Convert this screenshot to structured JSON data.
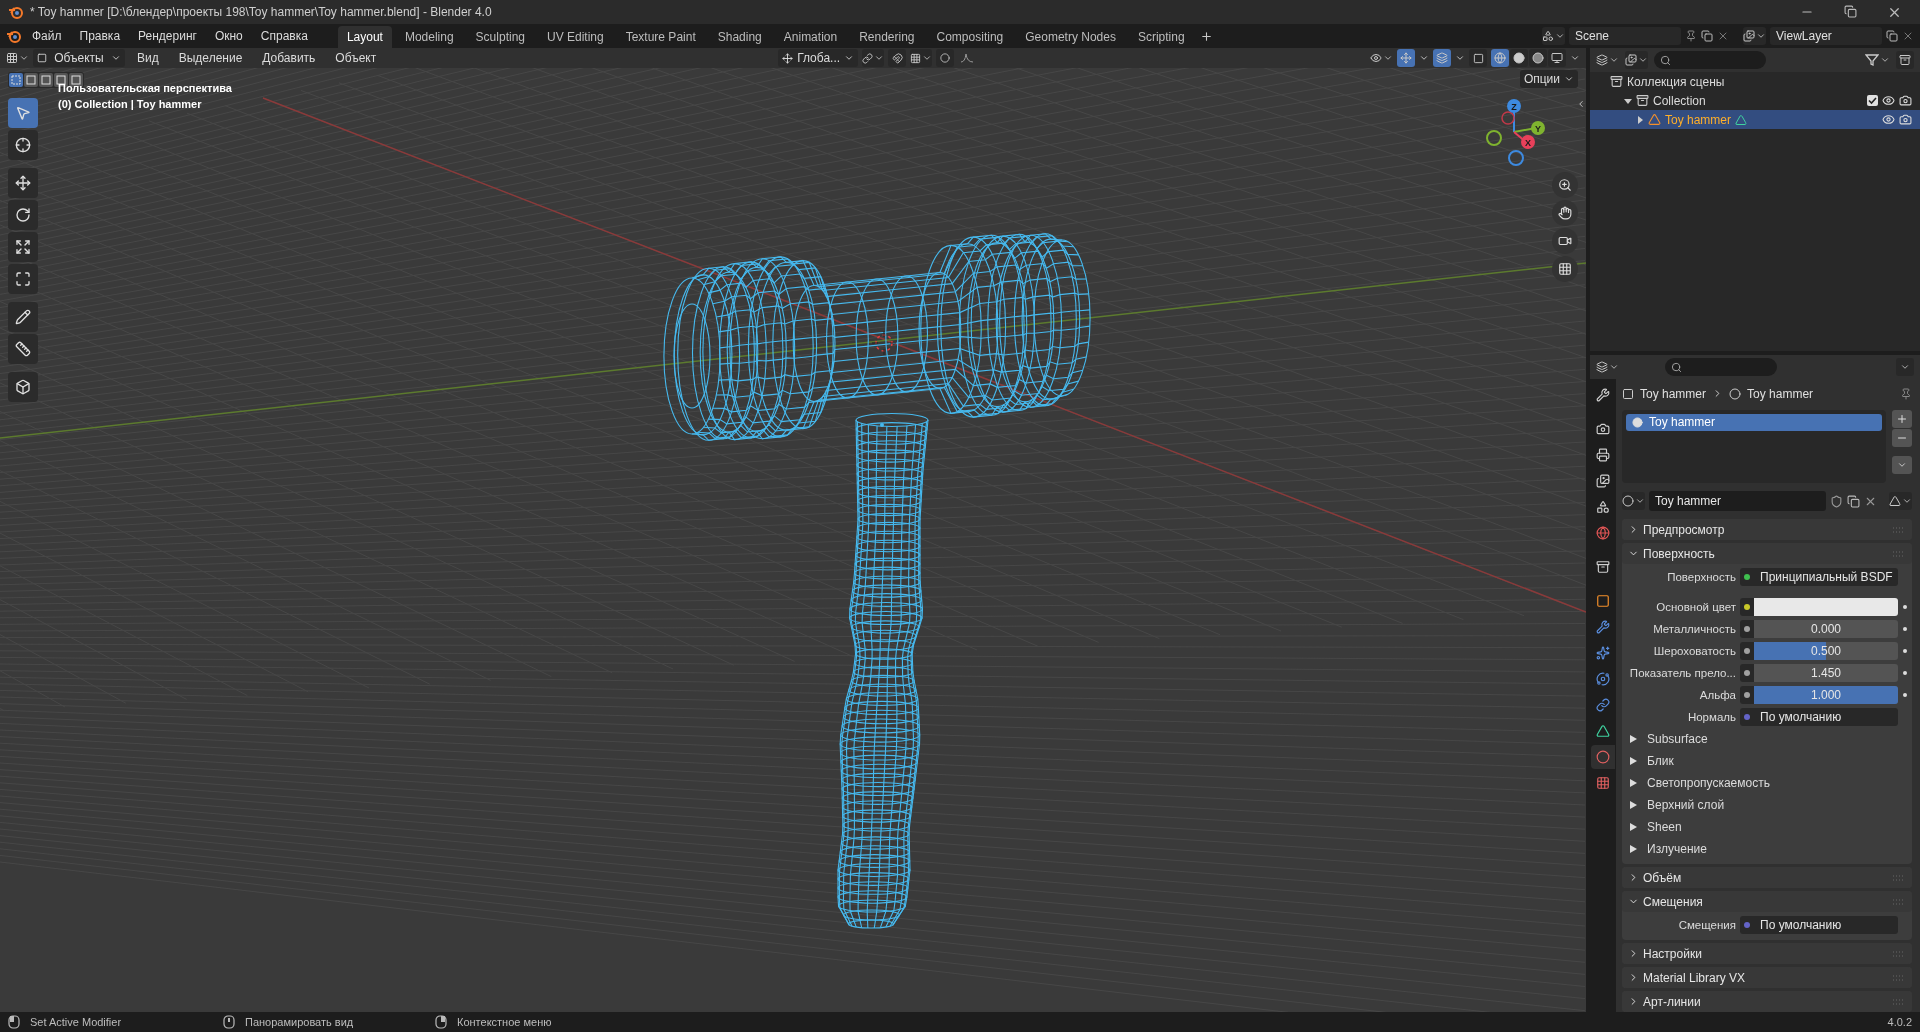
{
  "window": {
    "title": "* Toy hammer [D:\\блендер\\проекты 198\\Toy hammer\\Toy hammer.blend] - Blender 4.0"
  },
  "menu": [
    "Файл",
    "Правка",
    "Рендеринг",
    "Окно",
    "Справка"
  ],
  "workspaces": [
    {
      "label": "Layout",
      "selected": true
    },
    {
      "label": "Modeling",
      "selected": false
    },
    {
      "label": "Sculpting",
      "selected": false
    },
    {
      "label": "UV Editing",
      "selected": false
    },
    {
      "label": "Texture Paint",
      "selected": false
    },
    {
      "label": "Shading",
      "selected": false
    },
    {
      "label": "Animation",
      "selected": false
    },
    {
      "label": "Rendering",
      "selected": false
    },
    {
      "label": "Compositing",
      "selected": false
    },
    {
      "label": "Geometry Nodes",
      "selected": false
    },
    {
      "label": "Scripting",
      "selected": false
    }
  ],
  "scene": "Scene",
  "view_layer": "ViewLayer",
  "viewport": {
    "mode": "Объекты",
    "menu": [
      "Вид",
      "Выделение",
      "Добавить",
      "Объект"
    ],
    "orientation": "Глоба...",
    "options": "Опции",
    "view_name": "Пользовательская перспектива",
    "context": "(0) Collection | Toy hammer",
    "select_modes": [
      {
        "selected": true
      },
      {
        "selected": false
      },
      {
        "selected": false
      },
      {
        "selected": false
      },
      {
        "selected": false
      }
    ],
    "shading": [
      {
        "kind": "wireframe",
        "selected": true
      },
      {
        "kind": "solid",
        "selected": false
      },
      {
        "kind": "material",
        "selected": false
      },
      {
        "kind": "rendered",
        "selected": false
      }
    ],
    "tools": [
      {
        "kind": "select",
        "selected": true
      },
      {
        "kind": "cursor",
        "selected": false
      },
      {
        "kind": "move",
        "selected": false
      },
      {
        "kind": "rotate",
        "selected": false
      },
      {
        "kind": "scale",
        "selected": false
      },
      {
        "kind": "transform",
        "selected": false
      },
      {
        "kind": "annotate",
        "selected": false
      },
      {
        "kind": "measure",
        "selected": false
      },
      {
        "kind": "add_cube",
        "selected": false
      }
    ],
    "axes": {
      "z": "Z",
      "y": "Y",
      "x": "X"
    }
  },
  "outliner": {
    "root": "Коллекция сцены",
    "collections": [
      {
        "label": "Collection",
        "expanded": true,
        "checked": true,
        "children": [
          {
            "label": "Toy hammer",
            "selected": true,
            "expanded": false
          }
        ]
      }
    ]
  },
  "properties": {
    "tabs": [
      {
        "kind": "tool",
        "selected": false
      },
      {
        "kind": "render",
        "selected": false
      },
      {
        "kind": "output",
        "selected": false
      },
      {
        "kind": "view_layer",
        "selected": false
      },
      {
        "kind": "scene",
        "selected": false
      },
      {
        "kind": "world",
        "selected": false
      },
      {
        "kind": "collection",
        "selected": false
      },
      {
        "kind": "object",
        "selected": false
      },
      {
        "kind": "modifiers",
        "selected": false
      },
      {
        "kind": "particles",
        "selected": false
      },
      {
        "kind": "physics",
        "selected": false
      },
      {
        "kind": "constraints",
        "selected": false
      },
      {
        "kind": "data",
        "selected": false
      },
      {
        "kind": "material",
        "selected": true
      },
      {
        "kind": "texture",
        "selected": false
      }
    ],
    "breadcrumb": [
      "Toy hammer",
      "Toy hammer"
    ],
    "slots": [
      {
        "label": "Toy hammer",
        "selected": true
      }
    ],
    "material": "Toy hammer",
    "panels": [
      {
        "title": "Предпросмотр",
        "expanded": false
      },
      {
        "title": "Поверхность",
        "expanded": true,
        "rows": [
          {
            "kind": "link",
            "label": "Поверхность",
            "value": "Принципиальный BSDF",
            "color": "#3fbf4f"
          },
          {
            "kind": "color",
            "label": "Основной цвет",
            "swatch": {
              "color": "#e8e8e8"
            },
            "color": "#c7c729"
          },
          {
            "kind": "slider",
            "label": "Металличность",
            "value": "0.000",
            "level": 0,
            "color": "#a1a1a1"
          },
          {
            "kind": "slider",
            "label": "Шероховатость",
            "value": "0.500",
            "level": 0.5,
            "color": "#a1a1a1"
          },
          {
            "kind": "number",
            "label": "Показатель прело...",
            "value": "1.450",
            "color": "#a1a1a1"
          },
          {
            "kind": "slider",
            "label": "Альфа",
            "value": "1.000",
            "level": 1,
            "color": "#a1a1a1"
          },
          {
            "kind": "link",
            "label": "Нормаль",
            "value": "По умолчанию",
            "color": "#6363c7"
          },
          {
            "kind": "subpanel",
            "label": "Subsurface"
          },
          {
            "kind": "subpanel",
            "label": "Блик"
          },
          {
            "kind": "subpanel",
            "label": "Светопропускаемость"
          },
          {
            "kind": "subpanel",
            "label": "Верхний слой"
          },
          {
            "kind": "subpanel",
            "label": "Sheen"
          },
          {
            "kind": "subpanel",
            "label": "Излучение"
          }
        ]
      },
      {
        "title": "Объём",
        "expanded": false
      },
      {
        "title": "Смещения",
        "expanded": true,
        "rows": [
          {
            "kind": "link",
            "label": "Смещения",
            "value": "По умолчанию",
            "color": "#6363c7"
          }
        ]
      },
      {
        "title": "Настройки",
        "expanded": false
      },
      {
        "title": "Material Library VX",
        "expanded": false
      },
      {
        "title": "Арт-линии",
        "expanded": false
      }
    ]
  },
  "status_bar": {
    "items": [
      {
        "kind": "left",
        "label": "Set Active Modifier"
      },
      {
        "kind": "middle",
        "label": "Панорамировать вид"
      },
      {
        "kind": "right",
        "label": "Контекстное меню"
      }
    ],
    "version": "4.0.2"
  }
}
